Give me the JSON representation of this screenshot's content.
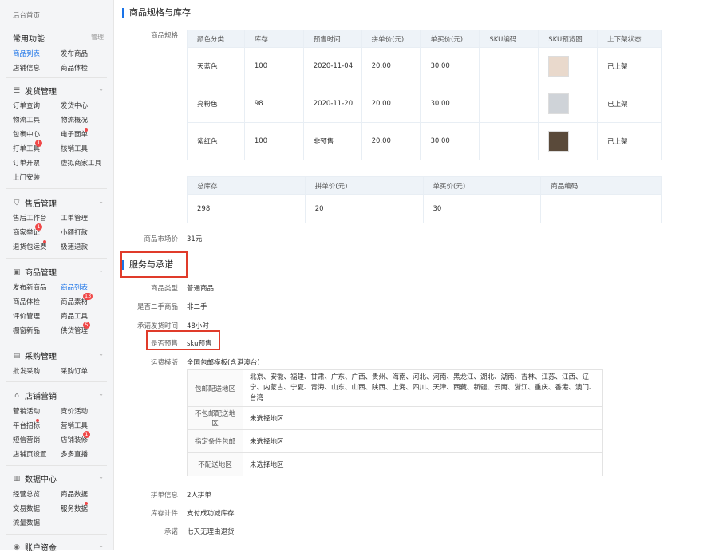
{
  "sidebar": {
    "home": "后台首页",
    "common": {
      "title": "常用功能",
      "manage": "管理",
      "items": [
        "商品列表",
        "发布商品",
        "店铺信息",
        "商品体检"
      ]
    },
    "sections": [
      {
        "title": "发货管理",
        "icon": "list-icon",
        "items": [
          "订单查询",
          "发货中心",
          "物流工具",
          "物流概况",
          "包裹中心",
          "电子面单",
          "打单工具",
          "核销工具",
          "订单开票",
          "虚拟商家工具",
          "上门安装"
        ]
      },
      {
        "title": "售后管理",
        "icon": "shield-icon",
        "items": [
          "售后工作台",
          "工单管理",
          "商家举证",
          "小额打款",
          "退货包运费",
          "极速退款"
        ]
      },
      {
        "title": "商品管理",
        "icon": "box-icon",
        "items": [
          "发布新商品",
          "商品列表",
          "商品体检",
          "商品素材",
          "评价管理",
          "商品工具",
          "橱窗新品",
          "供货管理"
        ]
      },
      {
        "title": "采购管理",
        "icon": "cart-icon",
        "items": [
          "批发采购",
          "采购订单"
        ]
      },
      {
        "title": "店铺营销",
        "icon": "store-icon",
        "items": [
          "营销活动",
          "竞价活动",
          "平台招标",
          "营销工具",
          "短信营销",
          "店铺装修",
          "店铺页设置",
          "多多直播"
        ]
      },
      {
        "title": "数据中心",
        "icon": "chart-icon",
        "items": [
          "经营总览",
          "商品数据",
          "交易数据",
          "服务数据",
          "流量数据"
        ]
      },
      {
        "title": "账户资金",
        "icon": "wallet-icon",
        "items": []
      }
    ],
    "badges": {
      "print_tool": "1",
      "merchant_proof": "1",
      "material": "13",
      "supply": "5",
      "decor": "1"
    }
  },
  "spec": {
    "section_title": "商品规格与库存",
    "label": "商品规格",
    "headers": [
      "颜色分类",
      "库存",
      "预售时间",
      "拼单价(元)",
      "单买价(元)",
      "SKU编码",
      "SKU预览图",
      "上下架状态"
    ],
    "rows": [
      {
        "color": "天蓝色",
        "stock": "100",
        "presale": "2020-11-04",
        "group_price": "20.00",
        "single_price": "30.00",
        "sku": "",
        "status": "已上架",
        "thumb_color": "#e9d9cc"
      },
      {
        "color": "亮粉色",
        "stock": "98",
        "presale": "2020-11-20",
        "group_price": "20.00",
        "single_price": "30.00",
        "sku": "",
        "status": "已上架",
        "thumb_color": "#cfd3d8"
      },
      {
        "color": "紫红色",
        "stock": "100",
        "presale": "非预售",
        "group_price": "20.00",
        "single_price": "30.00",
        "sku": "",
        "status": "已上架",
        "thumb_color": "#5a4a3a"
      }
    ],
    "summary_headers": [
      "总库存",
      "拼单价(元)",
      "单买价(元)",
      "商品编码"
    ],
    "summary": [
      "298",
      "20",
      "30",
      ""
    ],
    "market_price_label": "商品市场价",
    "market_price": "31元"
  },
  "service": {
    "section_title": "服务与承诺",
    "fields": [
      {
        "label": "商品类型",
        "value": "普通商品"
      },
      {
        "label": "是否二手商品",
        "value": "非二手"
      },
      {
        "label": "承诺发货时间",
        "value": "48小时"
      },
      {
        "label": "是否预售",
        "value": "sku预售"
      },
      {
        "label": "运费模版",
        "value": "全国包邮模板(含港澳台)"
      }
    ],
    "shipping": [
      {
        "key": "包邮配送地区",
        "value": "北京、安徽、福建、甘肃、广东、广西、贵州、海南、河北、河南、黑龙江、湖北、湖南、吉林、江苏、江西、辽宁、内蒙古、宁夏、青海、山东、山西、陕西、上海、四川、天津、西藏、新疆、云南、浙江、重庆、香港、澳门、台湾"
      },
      {
        "key": "不包邮配送地区",
        "value": "未选择地区"
      },
      {
        "key": "指定条件包邮",
        "value": "未选择地区"
      },
      {
        "key": "不配送地区",
        "value": "未选择地区"
      }
    ],
    "tail": [
      {
        "label": "拼单信息",
        "value": "2人拼单"
      },
      {
        "label": "库存计件",
        "value": "支付成功减库存"
      },
      {
        "label": "承诺",
        "value": "七天无理由退货"
      }
    ]
  }
}
